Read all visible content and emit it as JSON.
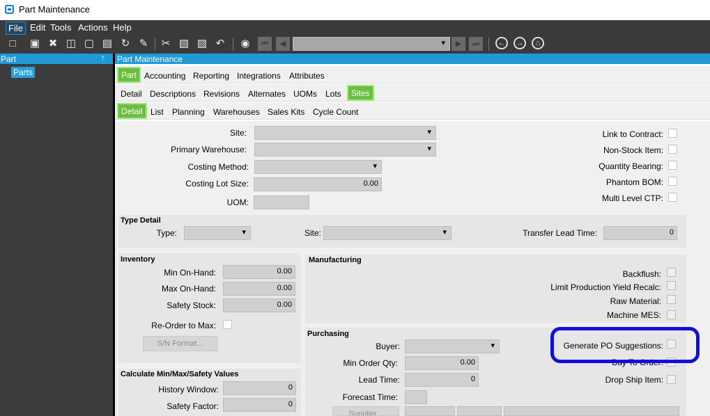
{
  "window": {
    "title": "Part Maintenance"
  },
  "menu": [
    "File",
    "Edit",
    "Tools",
    "Actions",
    "Help"
  ],
  "toolbar": {
    "icons": [
      "new-icon",
      "save-icon",
      "delete-icon",
      "open-book-icon",
      "note-icon",
      "clip-icon",
      "refresh-icon",
      "brush-icon",
      "cut-icon",
      "copy-icon",
      "paste-icon",
      "undo-icon",
      "binoculars-icon",
      "first-icon",
      "prev-icon",
      "next-icon",
      "last-icon",
      "back-icon",
      "forward-icon",
      "home-icon"
    ]
  },
  "left_panel": {
    "header": "Part",
    "pin": "↑",
    "tree": [
      "Parts"
    ]
  },
  "main": {
    "header": "Part Maintenance"
  },
  "tabs1": [
    "Part",
    "Accounting",
    "Reporting",
    "Integrations",
    "Attributes"
  ],
  "tabs2": [
    "Detail",
    "Descriptions",
    "Revisions",
    "Alternates",
    "UOMs",
    "Lots",
    "Sites"
  ],
  "tabs3": [
    "Detail",
    "List",
    "Planning",
    "Warehouses",
    "Sales Kits",
    "Cycle Count"
  ],
  "top_fields": {
    "site": "Site:",
    "primary_warehouse": "Primary Warehouse:",
    "costing_method": "Costing Method:",
    "costing_lot_size": "Costing Lot Size:",
    "costing_lot_size_value": "0.00",
    "uom": "UOM:"
  },
  "top_checks": [
    "Link to Contract:",
    "Non-Stock Item:",
    "Quantity Bearing:",
    "Phantom BOM:",
    "Multi Level CTP:"
  ],
  "type_detail": {
    "title": "Type Detail",
    "type": "Type:",
    "site": "Site:",
    "transfer_lead_time": "Transfer Lead Time:",
    "transfer_lead_time_value": "0"
  },
  "inventory": {
    "title": "Inventory",
    "min_on_hand": "Min On-Hand:",
    "min_on_hand_value": "0.00",
    "max_on_hand": "Max On-Hand:",
    "max_on_hand_value": "0.00",
    "safety_stock": "Safety Stock:",
    "safety_stock_value": "0.00",
    "reorder_to_max": "Re-Order to Max:",
    "sn_format": "S/N Format..."
  },
  "calc": {
    "title": "Calculate Min/Max/Safety Values",
    "history_window": "History Window:",
    "history_window_value": "0",
    "safety_factor": "Safety Factor:",
    "safety_factor_value": "0"
  },
  "manufacturing": {
    "title": "Manufacturing",
    "backflush": "Backflush:",
    "limit_yield": "Limit Production Yield Recalc:",
    "raw_material": "Raw Material:",
    "machine_mes": "Machine MES:"
  },
  "purchasing": {
    "title": "Purchasing",
    "buyer": "Buyer:",
    "min_order_qty": "Min Order Qty:",
    "min_order_qty_value": "0.00",
    "lead_time": "Lead Time:",
    "lead_time_value": "0",
    "forecast_time": "Forecast Time:",
    "supplier": "Supplier...",
    "generate_po": "Generate PO Suggestions:",
    "buy_to_order": "Buy To Order:",
    "drop_ship": "Drop Ship Item:"
  },
  "annotation_color": "#1010d8"
}
